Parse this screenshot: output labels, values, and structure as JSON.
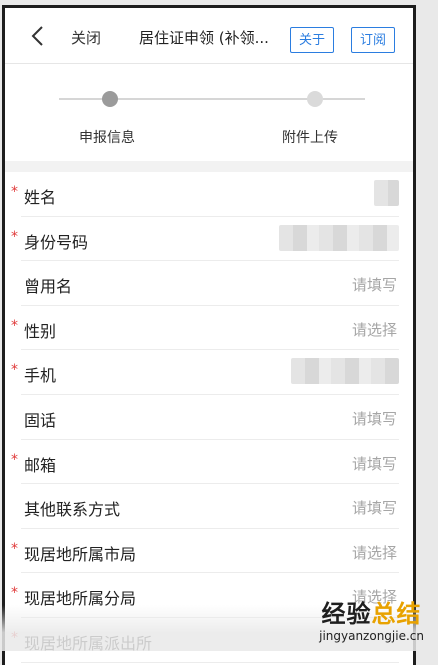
{
  "header": {
    "close_label": "关闭",
    "title": "居住证申领 (补领...",
    "about_label": "关于",
    "subscribe_label": "订阅"
  },
  "steps": [
    {
      "label": "申报信息",
      "active": true
    },
    {
      "label": "附件上传",
      "active": false
    }
  ],
  "form": {
    "rows": [
      {
        "label": "姓名",
        "required": true,
        "value": "",
        "masked": true
      },
      {
        "label": "身份号码",
        "required": true,
        "value": "",
        "masked": true
      },
      {
        "label": "曾用名",
        "required": false,
        "value": "请填写"
      },
      {
        "label": "性别",
        "required": true,
        "value": "请选择"
      },
      {
        "label": "手机",
        "required": true,
        "value": "",
        "masked": true
      },
      {
        "label": "固话",
        "required": false,
        "value": "请填写"
      },
      {
        "label": "邮箱",
        "required": true,
        "value": "请填写"
      },
      {
        "label": "其他联系方式",
        "required": false,
        "value": "请填写"
      },
      {
        "label": "现居地所属市局",
        "required": true,
        "value": "请选择"
      },
      {
        "label": "现居地所属分局",
        "required": true,
        "value": "请选择"
      },
      {
        "label": "现居地所属派出所",
        "required": true,
        "value": ""
      }
    ]
  },
  "watermark": {
    "title_part1": "经验",
    "title_part2": "总结",
    "url": "jingyanzongjie.cn"
  },
  "colors": {
    "accent_blue": "#2b7de0",
    "required_red": "#e03a3a"
  }
}
